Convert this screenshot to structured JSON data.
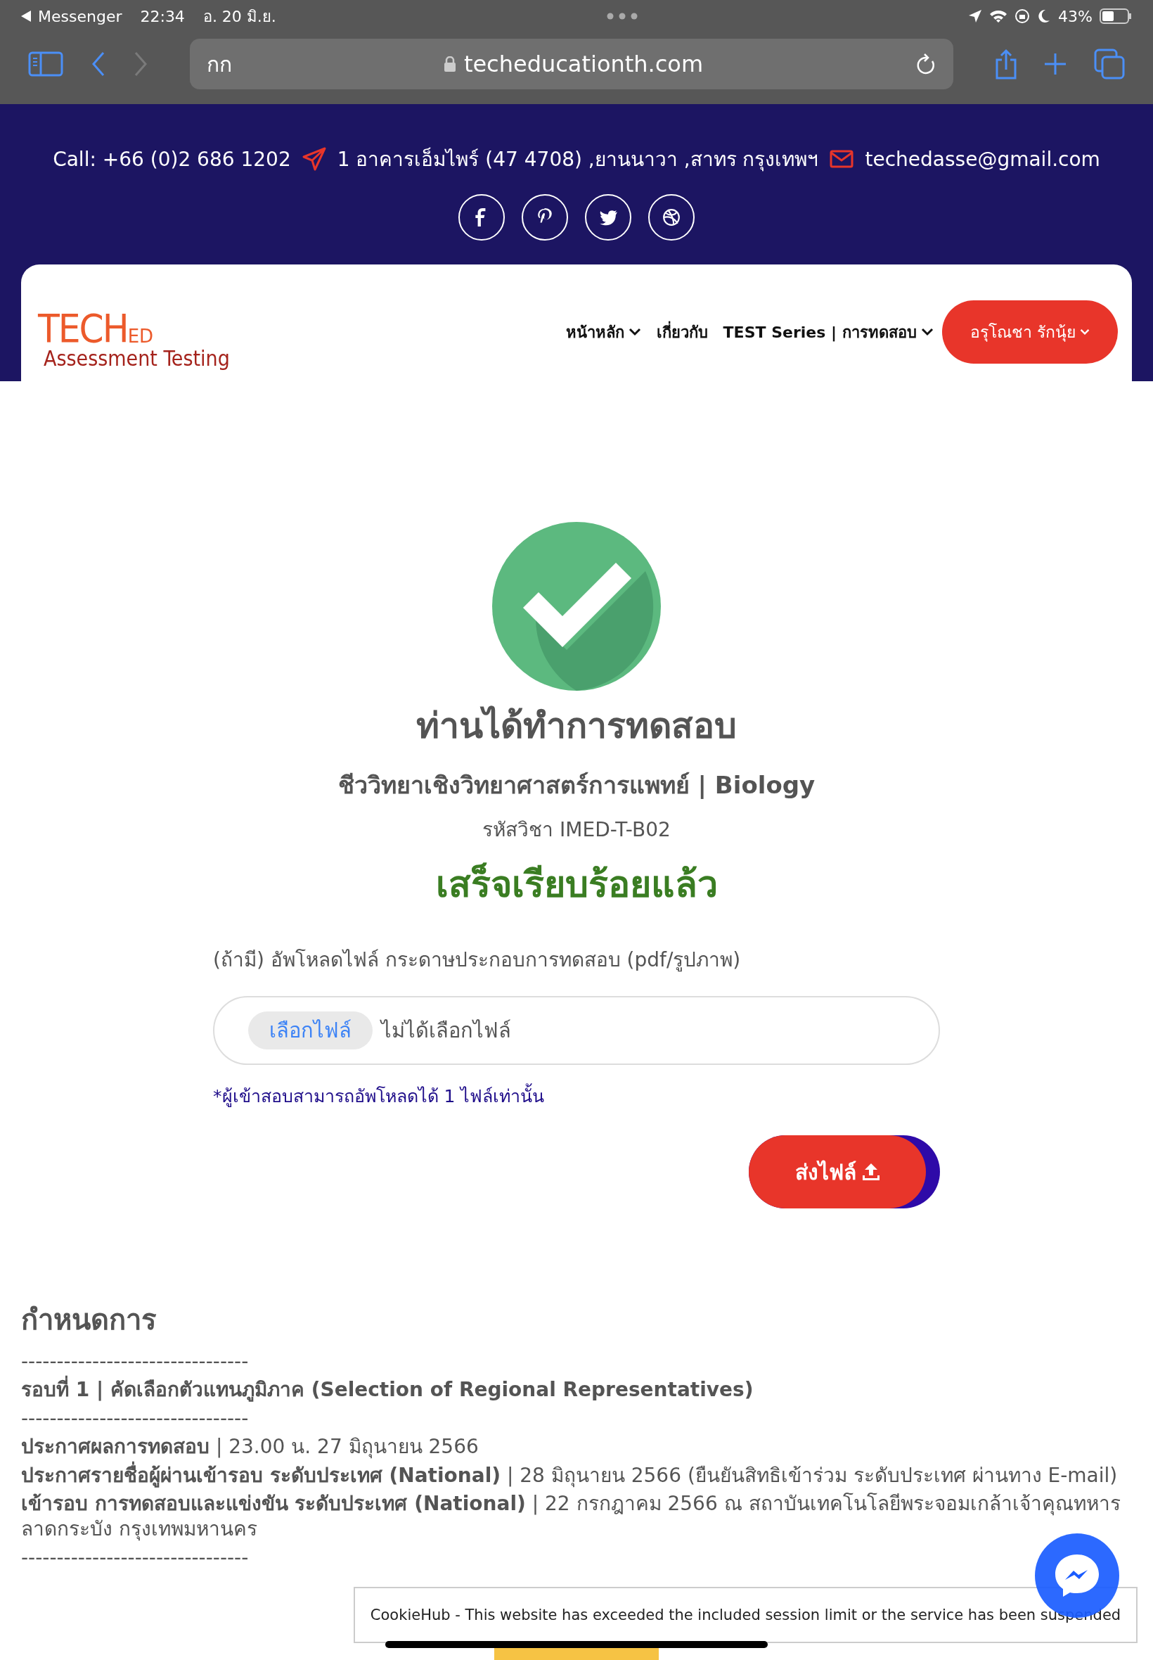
{
  "status_bar": {
    "back_app": "Messenger",
    "time": "22:34",
    "date": "อ. 20 มิ.ย.",
    "battery": "43%"
  },
  "browser": {
    "text_size": "กก",
    "url": "techeducationth.com"
  },
  "contact": {
    "phone": "Call: +66 (0)2 686 1202",
    "address": "1 อาคารเอ็มไพร์ (47 4708) ,ยานนาวา ,สาทร กรุงเทพฯ",
    "email": "techedasse@gmail.com"
  },
  "logo": {
    "brand": "TECH",
    "suffix": "ED",
    "tagline": "Assessment Testing"
  },
  "nav": {
    "items": [
      {
        "label": "หน้าหลัก",
        "dropdown": true
      },
      {
        "label": "เกี่ยวกับ",
        "dropdown": false
      },
      {
        "label": "TEST Series | การทดสอบ",
        "dropdown": true
      }
    ],
    "user_button": {
      "label": "อรุโณชา รักนุ้ย",
      "dropdown": true
    }
  },
  "result": {
    "title": "ท่านได้ทำการทดสอบ",
    "subject": "ชีววิทยาเชิงวิทยาศาสตร์การแพทย์ | Biology",
    "code": "รหัสวิชา IMED-T-B02",
    "status": "เสร็จเรียบร้อยแล้ว"
  },
  "upload": {
    "label": "(ถ้ามี) อัพโหลดไฟล์ กระดาษประกอบการทดสอบ (pdf/รูปภาพ)",
    "choose_button": "เลือกไฟล์",
    "file_status": "ไม่ได้เลือกไฟล์",
    "note": "*ผู้เข้าสอบสามารถอัพโหลดได้ 1 ไฟล์เท่านั้น",
    "submit": "ส่งไฟล์"
  },
  "schedule": {
    "heading": "กำหนดการ",
    "lines": [
      {
        "kind": "rule",
        "text": "--------------------------------"
      },
      {
        "kind": "heading",
        "text": "รอบที่ 1 | คัดเลือกตัวแทนภูมิภาค (Selection of Regional Representatives)"
      },
      {
        "kind": "rule",
        "text": "--------------------------------"
      },
      {
        "kind": "text",
        "text": "**ประกาศผลการทดสอบ** | 23.00 น. 27 มิถุนายน 2566"
      },
      {
        "kind": "text",
        "text": "**ประกาศรายชื่อผู้ผ่านเข้ารอบ ระดับประเทศ (National)** | 28 มิถุนายน 2566 (ยืนยันสิทธิเข้าร่วม ระดับประเทศ ผ่านทาง E-mail)"
      },
      {
        "kind": "text",
        "text": "**เข้ารอบ การทดสอบและแข่งขัน ระดับประเทศ (National)** | 22 กรกฎาคม 2566 ณ สถาบันเทคโนโลยีพระจอมเกล้าเจ้าคุณทหารลาดกระบัง กรุงเทพมหานคร"
      },
      {
        "kind": "rule",
        "text": "--------------------------------"
      }
    ]
  },
  "cookie": {
    "text": "CookieHub - This website has exceeded the included session limit or the service has been suspended"
  }
}
